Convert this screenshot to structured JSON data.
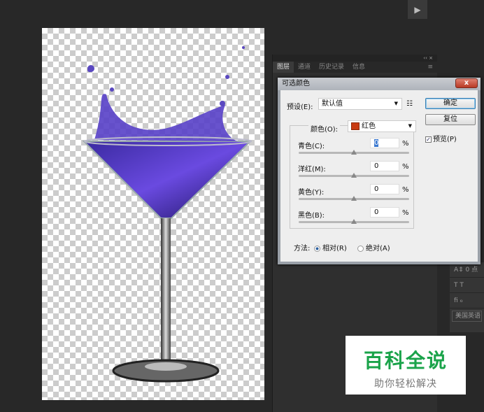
{
  "toolbar": {
    "play_icon": "▶"
  },
  "panel": {
    "collapse": "‹‹ ×",
    "tabs": [
      "图层",
      "通道",
      "历史记录",
      "信息"
    ],
    "menu_icon": "≡"
  },
  "right_panel": {
    "spacing": "A⇕ 0 点",
    "type_row": "T T",
    "lig_row": "fi ℴ",
    "language": "美国英语"
  },
  "dialog": {
    "title": "可选颜色",
    "close": "x",
    "preset_label": "预设(E):",
    "preset_value": "默认值",
    "preset_menu_icon": "☷",
    "ok": "确定",
    "reset": "复位",
    "preview_label": "预览(P)",
    "preview_checked": true,
    "color_label": "颜色(O):",
    "color_value": "红色",
    "color_swatch": "#c83a10",
    "sliders": [
      {
        "label": "青色(C):",
        "value": "0",
        "unit": "%",
        "position": 0.5
      },
      {
        "label": "洋红(M):",
        "value": "0",
        "unit": "%",
        "position": 0.5
      },
      {
        "label": "黄色(Y):",
        "value": "0",
        "unit": "%",
        "position": 0.5
      },
      {
        "label": "黑色(B):",
        "value": "0",
        "unit": "%",
        "position": 0.5
      }
    ],
    "method_label": "方法:",
    "relative": "相对(R)",
    "absolute": "绝对(A)",
    "method_selected": "relative"
  },
  "watermark": {
    "title": "百科全说",
    "subtitle": "助你轻松解决"
  }
}
